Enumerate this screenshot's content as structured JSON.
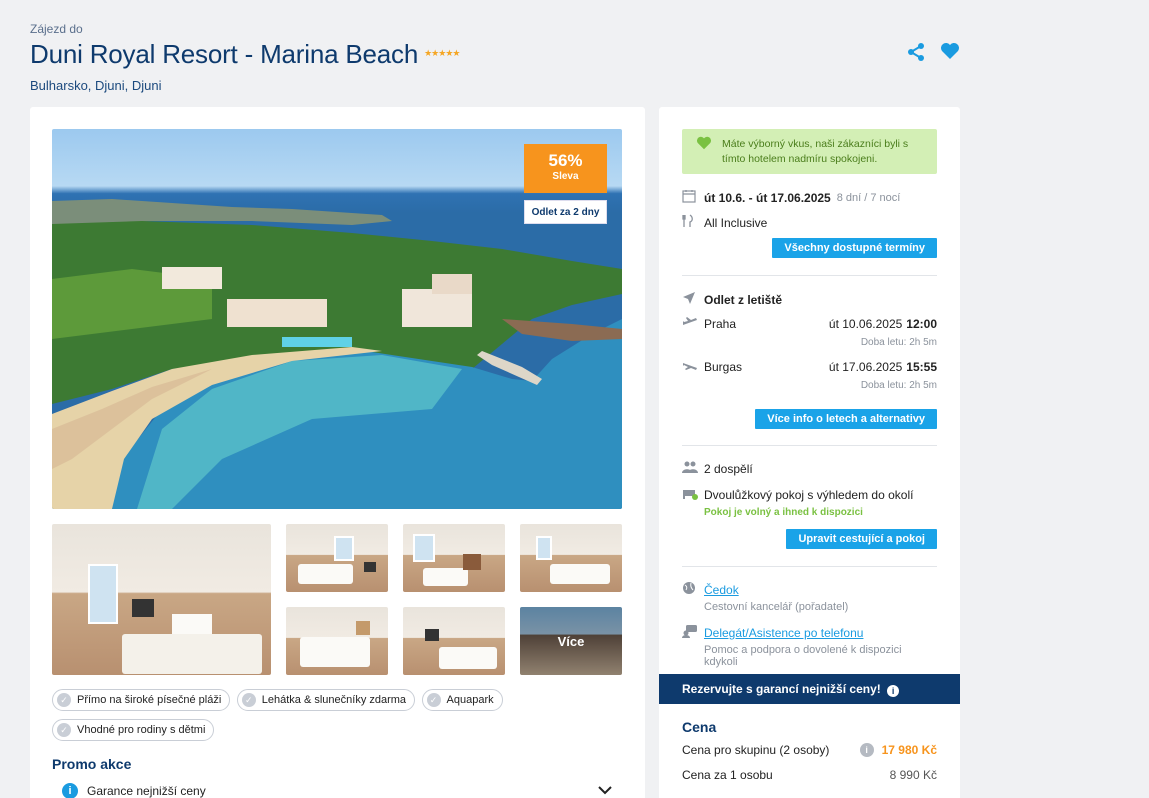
{
  "header": {
    "overline": "Zájezd do",
    "title": "Duni Royal Resort - Marina Beach",
    "stars": "★★★★★",
    "location": "Bulharsko, Djuni, Djuni"
  },
  "gallery": {
    "discount_pct": "56%",
    "discount_label": "Sleva",
    "departure_badge": "Odlet za 2 dny",
    "more_label": "Více"
  },
  "features": [
    "Přímo na široké písečné pláži",
    "Lehátka & slunečníky zdarma",
    "Aquapark",
    "Vhodné pro rodiny s dětmi"
  ],
  "promo": {
    "title": "Promo akce",
    "item": "Garance nejnižší ceny"
  },
  "sidebar": {
    "compliment": "Máte výborný vkus, naši zákazníci byli s tímto hotelem nadmíru spokojeni.",
    "dates": "út 10.6. - út 17.06.2025",
    "duration": "8 dní / 7 nocí",
    "board": "All Inclusive",
    "all_dates_btn": "Všechny dostupné termíny",
    "departure_title": "Odlet z letiště",
    "outbound_city": "Praha",
    "outbound_date": "út 10.06.2025",
    "outbound_time": "12:00",
    "outbound_duration": "Doba letu: 2h 5m",
    "return_city": "Burgas",
    "return_date": "út 17.06.2025",
    "return_time": "15:55",
    "return_duration": "Doba letu: 2h 5m",
    "flights_btn": "Více info o letech a alternativy",
    "travelers": "2 dospělí",
    "room": "Dvoulůžkový pokoj s výhledem do okolí",
    "room_status": "Pokoj je volný a ihned k dispozici",
    "edit_btn": "Upravit cestující a pokoj",
    "agency_link": "Čedok",
    "agency_desc": "Cestovní kancelář (pořadatel)",
    "assist_link": "Delegát/Asistence po telefonu",
    "assist_desc": "Pomoc a podpora o dovolené k dispozici kdykoli",
    "banner": "Rezervujte s garancí nejnižší ceny!",
    "price_title": "Cena",
    "group_price_label": "Cena pro skupinu (2 osoby)",
    "group_price": "17 980 Kč",
    "person_price_label": "Cena za 1 osobu",
    "person_price": "8 990 Kč"
  },
  "colors": {
    "brand": "#0e3a6d",
    "accent": "#1aa3e8",
    "discount": "#f7941d",
    "success": "#7ac142"
  }
}
